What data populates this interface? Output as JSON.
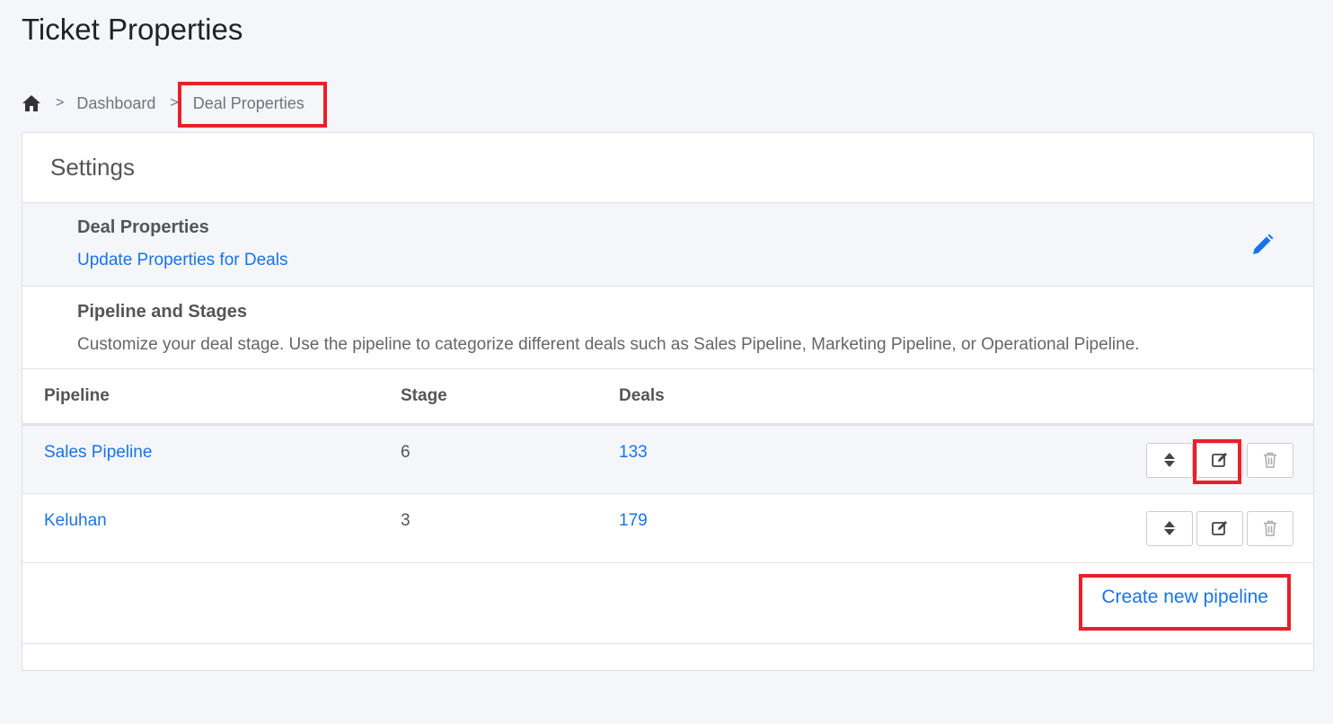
{
  "page": {
    "title": "Ticket Properties"
  },
  "breadcrumb": {
    "home_icon": "home-icon",
    "separator": ">",
    "items": [
      "Dashboard",
      "Deal Properties"
    ]
  },
  "card": {
    "header": "Settings",
    "deal_properties": {
      "title": "Deal Properties",
      "link": "Update Properties for Deals",
      "edit_icon": "pencil-icon"
    },
    "pipeline_section": {
      "title": "Pipeline and Stages",
      "description": "Customize your deal stage. Use the pipeline to categorize different deals such as Sales Pipeline, Marketing Pipeline, or Operational Pipeline."
    },
    "table": {
      "columns": [
        "Pipeline",
        "Stage",
        "Deals"
      ],
      "rows": [
        {
          "pipeline": "Sales Pipeline",
          "stage": "6",
          "deals": "133"
        },
        {
          "pipeline": "Keluhan",
          "stage": "3",
          "deals": "179"
        }
      ],
      "row_actions": [
        "sort-icon",
        "edit-icon",
        "trash-icon"
      ]
    },
    "create_button": "Create new pipeline"
  },
  "colors": {
    "accent": "#1a73e8",
    "highlight": "#e8202a",
    "background": "#f4f6f9"
  }
}
